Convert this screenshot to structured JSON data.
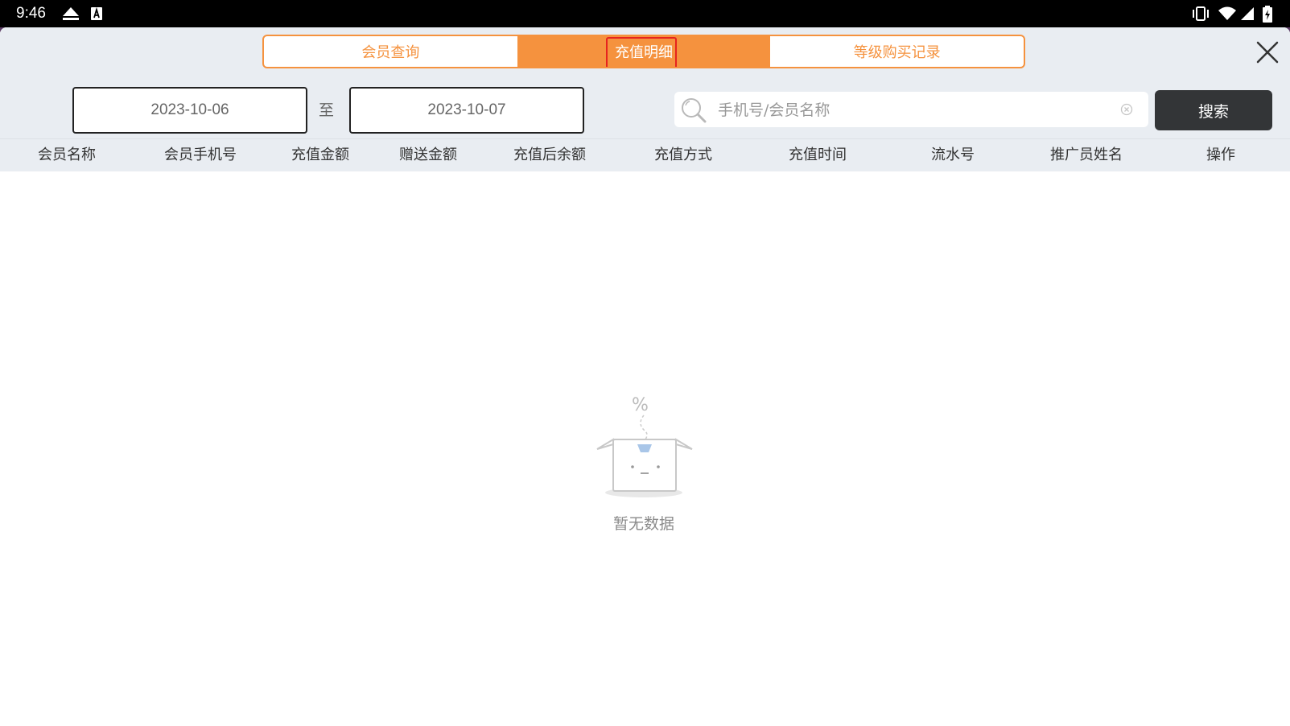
{
  "status_bar": {
    "time": "9:46"
  },
  "tabs": [
    {
      "label": "会员查询",
      "active": false
    },
    {
      "label": "充值明细",
      "active": true
    },
    {
      "label": "等级购买记录",
      "active": false
    }
  ],
  "filters": {
    "start_date": "2023-10-06",
    "date_separator": "至",
    "end_date": "2023-10-07"
  },
  "search": {
    "placeholder": "手机号/会员名称",
    "value": "",
    "button_label": "搜索"
  },
  "table": {
    "columns": [
      "会员名称",
      "会员手机号",
      "充值金额",
      "赠送金额",
      "充值后余额",
      "充值方式",
      "充值时间",
      "流水号",
      "推广员姓名",
      "操作"
    ],
    "rows": []
  },
  "empty_state": {
    "text": "暂无数据"
  },
  "colors": {
    "accent": "#f5923e",
    "highlight_border": "#e6231f",
    "search_button": "#333537",
    "header_bg": "#e9edf2"
  }
}
